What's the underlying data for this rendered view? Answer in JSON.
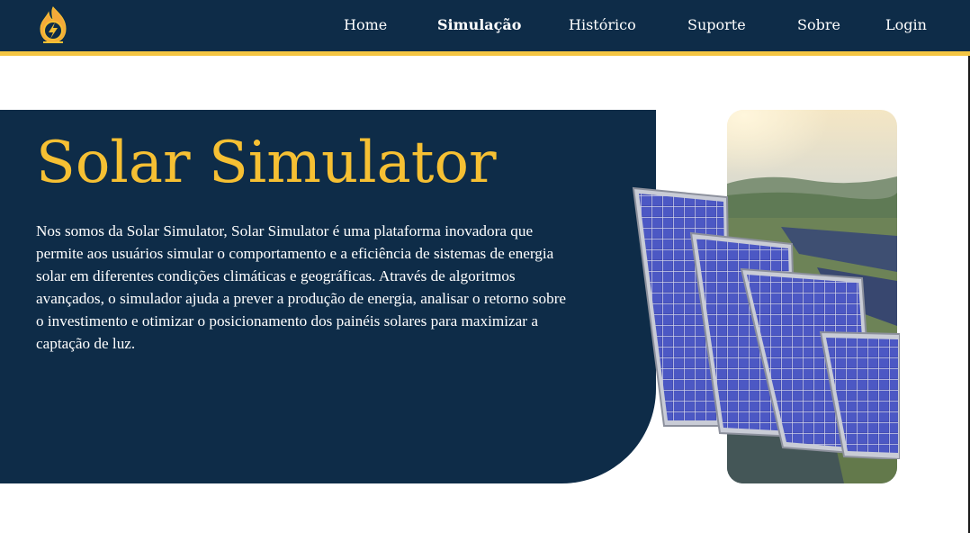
{
  "nav": {
    "items": [
      {
        "label": "Home"
      },
      {
        "label": "Simulação"
      },
      {
        "label": "Histórico"
      },
      {
        "label": "Suporte"
      },
      {
        "label": "Sobre"
      },
      {
        "label": "Login"
      }
    ],
    "active": "Simulação"
  },
  "hero": {
    "title": "Solar Simulator",
    "description": "Nos somos da Solar Simulator, Solar Simulator é uma plataforma inovadora que permite aos usuários simular o comportamento e a eficiência de sistemas de energia solar em diferentes condições climáticas e geográficas. Através de algoritmos avançados, o simulador ajuda a prever a produção de energia, analisar o retorno sobre o investimento e otimizar o posicionamento dos painéis solares para maximizar a captação de luz."
  },
  "colors": {
    "navy": "#0e2c48",
    "accent_yellow": "#f4c542",
    "title_yellow": "#f6c033",
    "panel_blue": "#3b44a8"
  },
  "icons": {
    "logo": "solar-bolt-logo-icon"
  }
}
